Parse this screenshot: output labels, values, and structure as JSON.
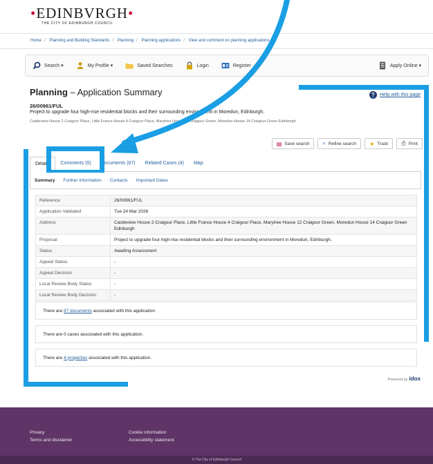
{
  "header": {
    "logo_text": "EDINBVRGH",
    "logo_subtitle": "THE CITY OF EDINBURGH COUNCIL"
  },
  "breadcrumb": [
    "Home",
    "Planning and Building Standards",
    "Planning",
    "Planning applications",
    "View and comment on planning applications"
  ],
  "menu": {
    "search": "Search ▾",
    "my_profile": "My Profile ▾",
    "saved_searches": "Saved Searches",
    "login": "Login",
    "register": "Register",
    "apply_online": "Apply Online ▾"
  },
  "page": {
    "title_bold": "Planning",
    "title_rest": " – Application Summary",
    "help": "Help with this page",
    "reference": "26/00961/FUL",
    "description": "Project to upgrade four high-rise residential blocks and their surrounding environment in Moredun, Edinburgh.",
    "address": "Castleview House 2 Craigour Place, Little France House 4 Craigour Place, Marytree House 12 Craigour Green, Moredun House 14 Craigour Green Edinburgh"
  },
  "actions": {
    "save_search": "Save search",
    "refine_search": "Refine search",
    "track": "Track",
    "print": "Print"
  },
  "tabs": [
    {
      "label": "Details"
    },
    {
      "label": "Comments (0)"
    },
    {
      "label": "Documents (87)"
    },
    {
      "label": "Related Cases (4)"
    },
    {
      "label": "Map"
    }
  ],
  "subtabs": [
    {
      "label": "Summary"
    },
    {
      "label": "Further Information"
    },
    {
      "label": "Contacts"
    },
    {
      "label": "Important Dates"
    }
  ],
  "summary_rows": [
    {
      "key": "Reference",
      "value": "26/00961/FUL"
    },
    {
      "key": "Application Validated",
      "value": "Tue 24 Mar 2026"
    },
    {
      "key": "Address",
      "value": "Castleview House 2 Craigour Place, Little France House 4 Craigour Place, Marytree House 12 Craigour Green, Moredun House 14 Craigour Green Edinburgh"
    },
    {
      "key": "Proposal",
      "value": "Project to upgrade four high-rise residential blocks and their surrounding environment in Moredun, Edinburgh."
    },
    {
      "key": "Status",
      "value": "Awaiting Assessment"
    },
    {
      "key": "Appeal Status",
      "value": "-"
    },
    {
      "key": "Appeal Decision",
      "value": "-"
    },
    {
      "key": "Local Review Body Status",
      "value": "-"
    },
    {
      "key": "Local Review Body Decision",
      "value": "-"
    }
  ],
  "info": {
    "docs_pre": "There are ",
    "docs_link": "87 documents",
    "docs_post": " associated with this application.",
    "cases_text": "There are 0 cases associated with this application.",
    "props_pre": "There are ",
    "props_link": "4 properties",
    "props_post": " associated with this application."
  },
  "powered_by": {
    "label": "Powered by",
    "brand": "idox"
  },
  "footer": {
    "privacy": "Privacy",
    "terms": "Terms and disclaimer",
    "cookie": "Cookie information",
    "accessibility": "Accessibility statement",
    "copyright": "© The City of Edinburgh Council"
  },
  "colors": {
    "annotation_blue": "#1a9ee4",
    "footer_purple": "#5e3566",
    "link_blue": "#1f5e9c"
  }
}
